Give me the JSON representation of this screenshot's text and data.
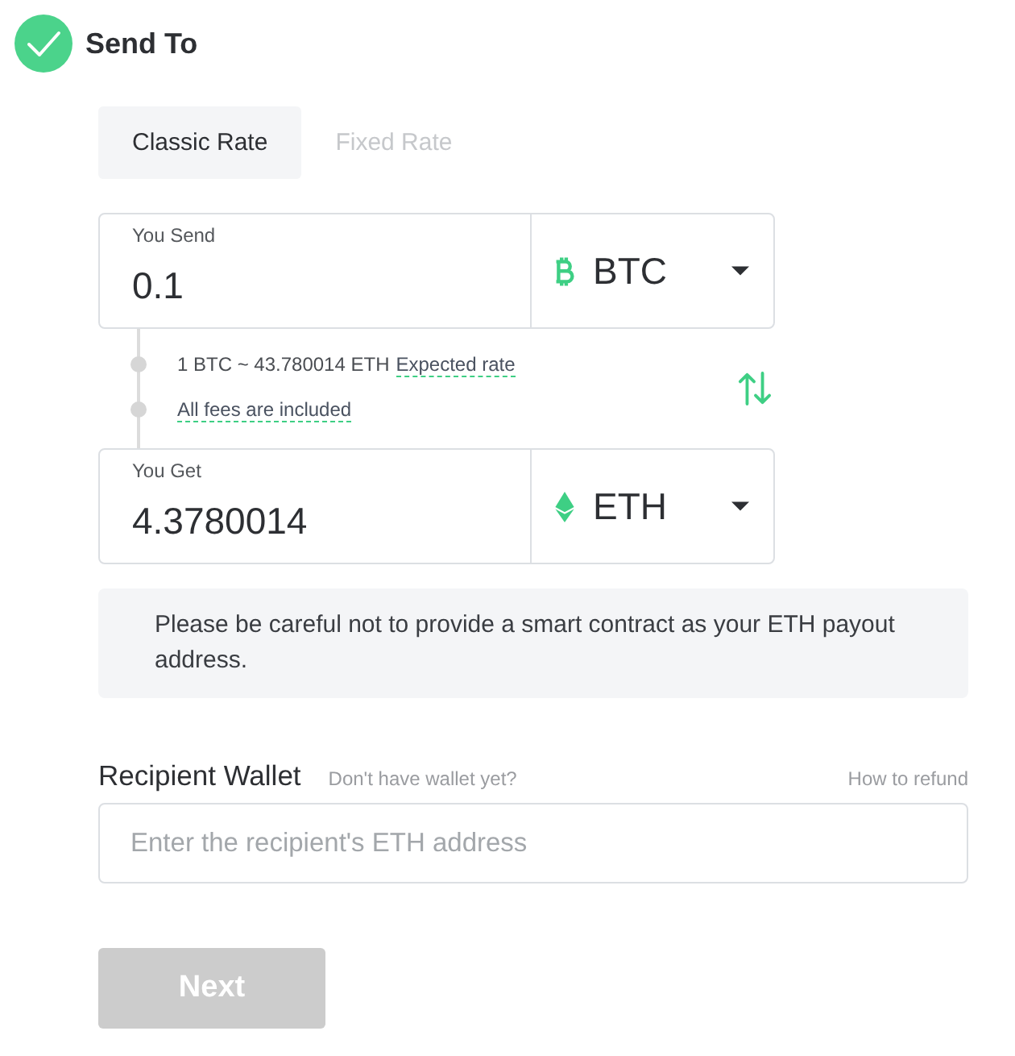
{
  "header": {
    "title": "Send To",
    "completed": true
  },
  "rate_tabs": [
    {
      "label": "Classic Rate",
      "selected": true
    },
    {
      "label": "Fixed Rate",
      "selected": false
    }
  ],
  "amounts": [
    {
      "label": "You Send",
      "value": "0.1",
      "currency": "BTC",
      "kind": "bitcoin"
    },
    {
      "label": "You Get",
      "value": "4.3780014",
      "currency": "ETH",
      "kind": "ether"
    }
  ],
  "rate": {
    "text": "1 BTC ~ 43.780014 ETH",
    "link": "Expected rate",
    "fees": "All fees are included"
  },
  "notice": "Please be careful not to provide a smart contract as your ETH payout address.",
  "recipient": {
    "label": "Recipient Wallet",
    "hint_link": "Don't have wallet yet?",
    "refund_link": "How to refund",
    "placeholder": "Enter the recipient's ETH address"
  },
  "next_button": {
    "label": "Next",
    "disabled": true
  }
}
